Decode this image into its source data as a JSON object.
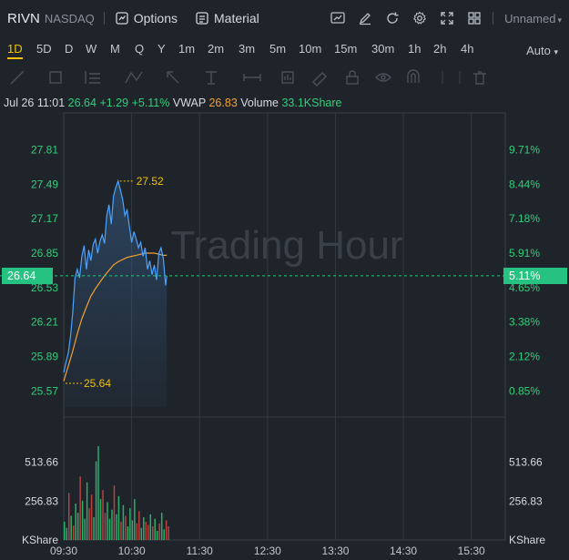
{
  "header": {
    "symbol": "RIVN",
    "exchange": "NASDAQ",
    "options_label": "Options",
    "material_label": "Material",
    "layout_name": "Unnamed"
  },
  "timeframes": [
    "1D",
    "5D",
    "D",
    "W",
    "M",
    "Q",
    "Y",
    "1m",
    "2m",
    "3m",
    "5m",
    "10m",
    "15m",
    "30m",
    "1h",
    "2h",
    "4h"
  ],
  "active_timeframe": "1D",
  "scale_mode": "Auto",
  "info": {
    "datetime": "Jul 26 11:01",
    "price": "26.64",
    "change": "+1.29",
    "change_pct": "+5.11%",
    "vwap_label": "VWAP",
    "vwap": "26.83",
    "volume_label": "Volume",
    "volume": "33.1KShare"
  },
  "watermark": "Trading Hour",
  "current_price_tag": "26.64",
  "current_pct_tag": "5.11%",
  "colors": {
    "up": "#2fcf7a",
    "vwap": "#f0a030",
    "price_line": "#4aa3ff",
    "highlight": "#f2c200",
    "tag_bg": "#26c281",
    "vol_down": "#e04848"
  },
  "chart_data": {
    "type": "line",
    "price_axis": {
      "ticks": [
        "27.81",
        "27.49",
        "27.17",
        "26.85",
        "26.53",
        "26.21",
        "25.89",
        "25.57"
      ],
      "ylim": [
        25.42,
        28.06
      ]
    },
    "pct_axis": {
      "ticks": [
        "9.71%",
        "8.44%",
        "7.18%",
        "5.91%",
        "4.65%",
        "3.38%",
        "2.12%",
        "0.85%"
      ]
    },
    "volume_axis": {
      "ticks": [
        "513.66",
        "256.83"
      ],
      "unit": "KShare"
    },
    "x_ticks": [
      "09:30",
      "10:30",
      "11:30",
      "12:30",
      "13:30",
      "14:30",
      "15:30"
    ],
    "high_label": "27.52",
    "low_label": "25.64",
    "series": [
      {
        "name": "Price",
        "x": [
          0,
          2,
          4,
          6,
          8,
          10,
          12,
          14,
          16,
          18,
          20,
          22,
          24,
          26,
          28,
          30,
          32,
          34,
          36,
          38,
          40,
          42,
          44,
          46,
          48,
          50,
          52,
          54,
          56,
          58,
          60,
          62,
          64,
          66,
          68,
          70,
          72,
          74,
          76,
          78,
          80,
          82,
          84,
          86,
          88,
          90,
          91
        ],
        "values": [
          25.74,
          25.84,
          25.92,
          26.08,
          26.3,
          26.62,
          26.7,
          26.62,
          26.82,
          26.92,
          26.7,
          26.88,
          26.78,
          26.93,
          26.98,
          26.85,
          26.96,
          27.02,
          26.94,
          27.2,
          27.3,
          27.12,
          27.38,
          27.46,
          27.52,
          27.44,
          27.35,
          27.2,
          27.25,
          27.1,
          26.95,
          27.05,
          26.98,
          26.9,
          26.95,
          26.82,
          26.9,
          26.7,
          26.78,
          26.65,
          26.74,
          26.6,
          26.85,
          26.9,
          26.8,
          26.55,
          26.64
        ]
      },
      {
        "name": "VWAP",
        "x": [
          0,
          4,
          8,
          12,
          16,
          20,
          24,
          28,
          32,
          36,
          40,
          44,
          48,
          52,
          56,
          60,
          64,
          68,
          72,
          76,
          80,
          84,
          88,
          91
        ],
        "values": [
          25.66,
          25.8,
          25.94,
          26.1,
          26.24,
          26.35,
          26.45,
          26.52,
          26.58,
          26.64,
          26.69,
          26.74,
          26.77,
          26.79,
          26.81,
          26.82,
          26.83,
          26.84,
          26.85,
          26.85,
          26.85,
          26.84,
          26.83,
          26.83
        ]
      }
    ],
    "volume_values": [
      120,
      80,
      310,
      160,
      95,
      240,
      180,
      420,
      260,
      140,
      380,
      210,
      300,
      150,
      520,
      620,
      270,
      330,
      180,
      250,
      140,
      200,
      360,
      170,
      290,
      120,
      230,
      160,
      90,
      210,
      130,
      270,
      110,
      190,
      80,
      150,
      120,
      100,
      170,
      90,
      140,
      60,
      110,
      180,
      70,
      130,
      90
    ],
    "volume_ylim": [
      0,
      770
    ]
  }
}
